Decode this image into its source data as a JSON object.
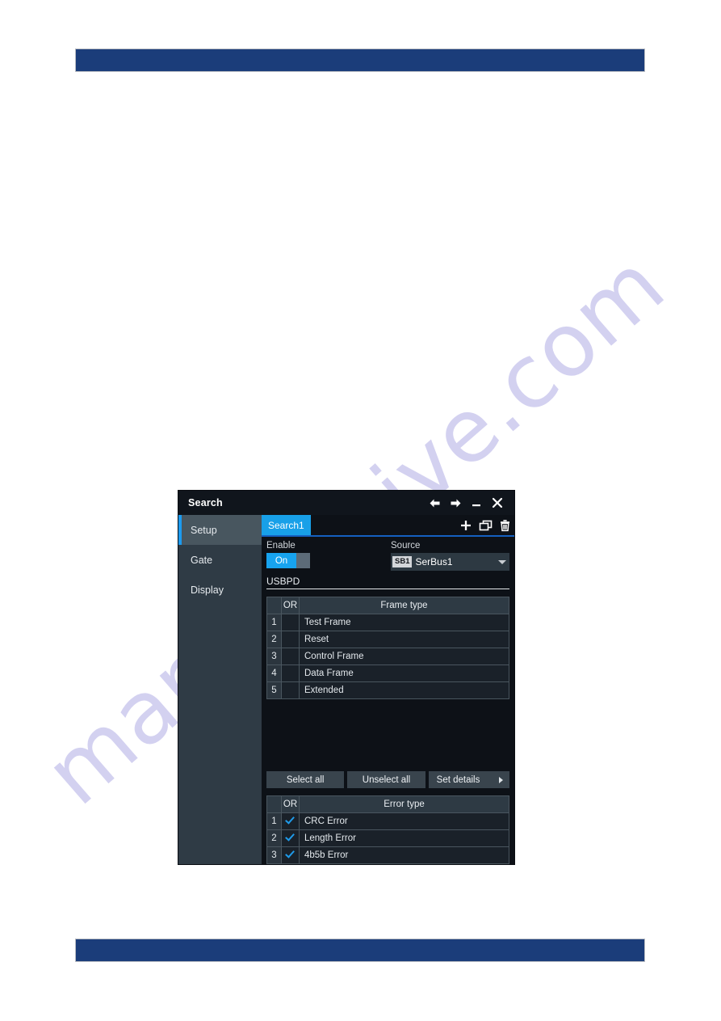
{
  "page": {
    "watermark": "manualshive.com",
    "header_bar_color": "#1b3d7a",
    "footer_bar_color": "#1b3d7a"
  },
  "dialog": {
    "title": "Search",
    "title_buttons": [
      {
        "name": "back-arrow-icon",
        "label": "←"
      },
      {
        "name": "forward-arrow-icon",
        "label": "→"
      },
      {
        "name": "minimize-icon",
        "label": "–"
      },
      {
        "name": "close-icon",
        "label": "✕"
      }
    ],
    "sidebar": {
      "items": [
        {
          "label": "Setup",
          "active": true
        },
        {
          "label": "Gate",
          "active": false
        },
        {
          "label": "Display",
          "active": false
        }
      ]
    },
    "tabs": {
      "active_tab": "Search1",
      "actions": [
        {
          "name": "add-icon",
          "label": "+"
        },
        {
          "name": "duplicate-icon",
          "label": "❐"
        },
        {
          "name": "delete-icon",
          "label": "Ὕ1"
        }
      ]
    },
    "setup": {
      "enable": {
        "label": "Enable",
        "value": "On"
      },
      "source": {
        "label": "Source",
        "badge": "SB1",
        "value": "SerBus1"
      },
      "protocol": "USBPD",
      "frame_table": {
        "col_or": "OR",
        "col_name": "Frame type",
        "rows": [
          {
            "index": "1",
            "name": "Test Frame",
            "checked": false
          },
          {
            "index": "2",
            "name": "Reset",
            "checked": false
          },
          {
            "index": "3",
            "name": "Control Frame",
            "checked": false
          },
          {
            "index": "4",
            "name": "Data Frame",
            "checked": false
          },
          {
            "index": "5",
            "name": "Extended",
            "checked": false
          }
        ]
      },
      "buttons": {
        "select_all": "Select all",
        "unselect_all": "Unselect all",
        "set_details": "Set details"
      },
      "error_table": {
        "col_or": "OR",
        "col_name": "Error type",
        "rows": [
          {
            "index": "1",
            "name": "CRC Error",
            "checked": true
          },
          {
            "index": "2",
            "name": "Length Error",
            "checked": true
          },
          {
            "index": "3",
            "name": "4b5b Error",
            "checked": true
          }
        ]
      }
    },
    "colors": {
      "accent_blue": "#18a0e8",
      "tab_underline": "#1560c0",
      "sidebar_active": "#48565f",
      "checkmark": "#1f9bea"
    }
  }
}
